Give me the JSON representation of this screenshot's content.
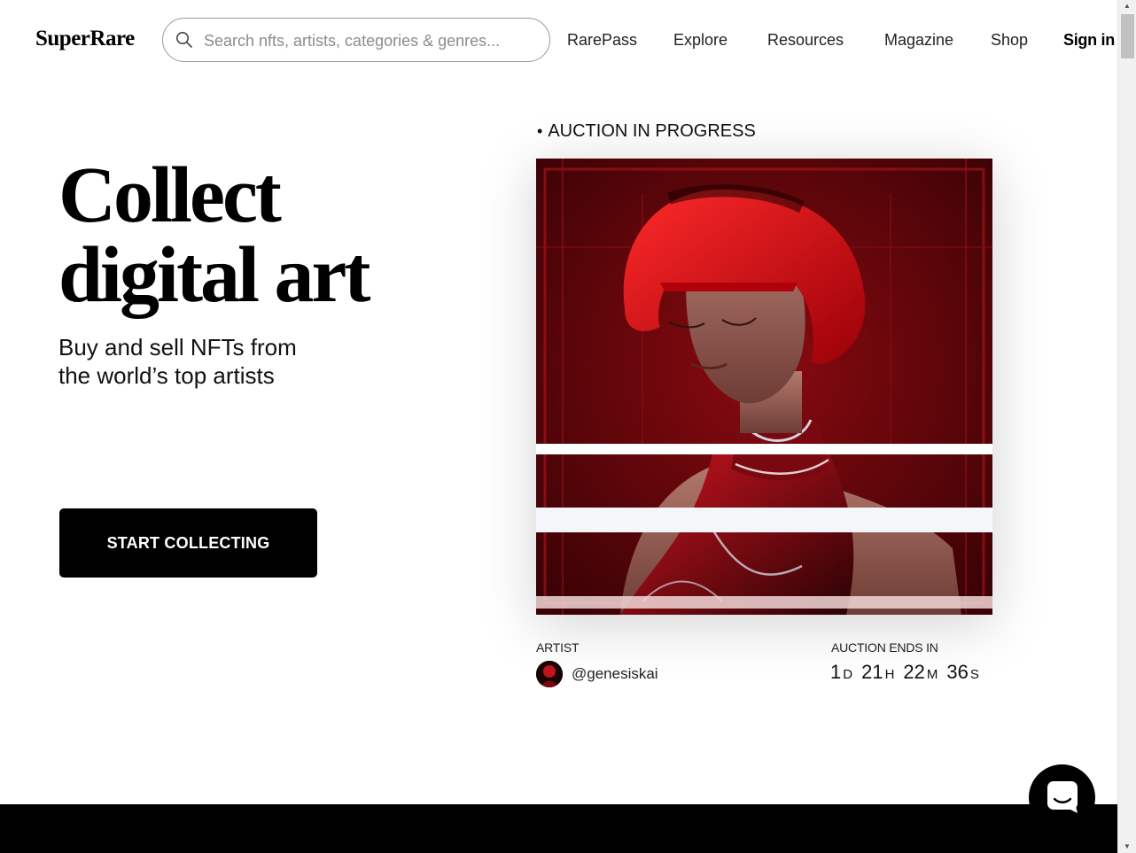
{
  "header": {
    "logo": "SuperRare",
    "search": {
      "placeholder": "Search nfts, artists, categories & genres..."
    },
    "nav": {
      "rarepass": "RarePass",
      "explore": "Explore",
      "resources": "Resources",
      "magazine": "Magazine",
      "shop": "Shop",
      "signin": "Sign in"
    }
  },
  "hero": {
    "title_line1": "Collect",
    "title_line2": "digital art",
    "subtitle_line1": "Buy and sell NFTs from",
    "subtitle_line2": "the world’s top artists",
    "cta": "START COLLECTING"
  },
  "auction": {
    "status": "AUCTION IN PROGRESS",
    "artist_label": "ARTIST",
    "artist_handle": "@genesiskai",
    "ends_label": "AUCTION ENDS IN",
    "countdown": {
      "days": "1",
      "days_unit": "D",
      "hours": "21",
      "hours_unit": "H",
      "minutes": "22",
      "minutes_unit": "M",
      "seconds": "36",
      "seconds_unit": "S"
    }
  },
  "icons": {
    "search": "search-icon",
    "chat": "chat-icon",
    "artist_avatar": "avatar"
  },
  "colors": {
    "primary": "#000000",
    "background": "#ffffff",
    "artwork_red": "#c0101a"
  }
}
